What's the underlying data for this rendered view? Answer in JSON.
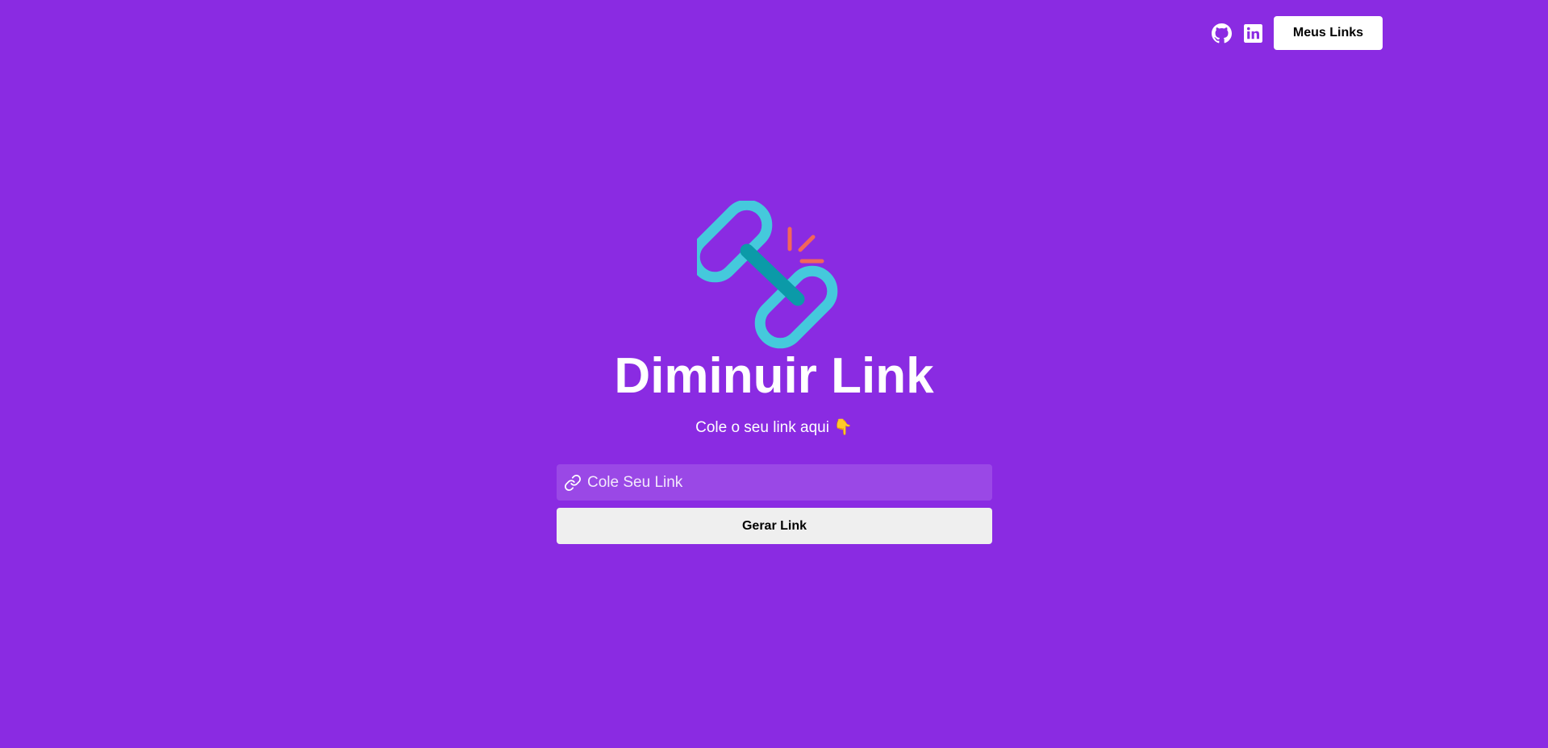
{
  "header": {
    "github_icon": "github-icon",
    "linkedin_icon": "linkedin-icon",
    "my_links_label": "Meus Links"
  },
  "hero": {
    "logo_icon": "broken-chain-link-icon",
    "title": "Diminuir Link",
    "subtitle": "Cole o seu link aqui 👇"
  },
  "form": {
    "input_icon": "link-icon",
    "input_placeholder": "Cole Seu Link",
    "input_value": "",
    "submit_label": "Gerar Link"
  },
  "colors": {
    "background": "#8a2be2",
    "chain_primary": "#45c9dc",
    "chain_dark": "#0b9aa8",
    "spark": "#f2665a",
    "button_light": "#efefef",
    "text": "#ffffff"
  }
}
